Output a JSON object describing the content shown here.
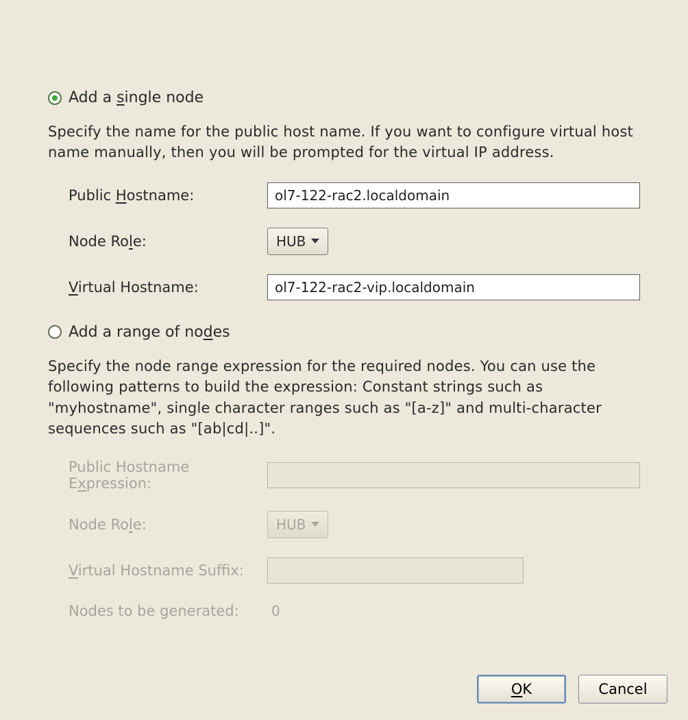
{
  "radio_single": {
    "label_pre": "Add a ",
    "label_mn": "s",
    "label_post": "ingle node",
    "selected": true
  },
  "desc_single": "Specify the name for the public host name. If you want to configure virtual host name manually, then you will be prompted for the virtual IP address.",
  "single": {
    "public_hostname": {
      "label_pre": "Public ",
      "label_mn": "H",
      "label_post": "ostname:",
      "value": "ol7-122-rac2.localdomain"
    },
    "node_role": {
      "label_pre": "Node Ro",
      "label_mn": "l",
      "label_post": "e:",
      "value": "HUB"
    },
    "virtual_hostname": {
      "label_mn": "V",
      "label_post": "irtual Hostname:",
      "value": "ol7-122-rac2-vip.localdomain"
    }
  },
  "radio_range": {
    "label_pre": "Add a range of no",
    "label_mn": "d",
    "label_post": "es",
    "selected": false
  },
  "desc_range": "Specify the node range expression for the required nodes. You can use the following patterns to build the expression: Constant strings such as \"myhostname\", single character ranges such as \"[a-z]\" and multi-character sequences such as \"[ab|cd|..]\".",
  "range": {
    "public_expr": {
      "label_pre": "Public Hostname E",
      "label_mn": "x",
      "label_post": "pression:",
      "value": ""
    },
    "node_role": {
      "label_pre": "Node Ro",
      "label_mn": "l",
      "label_post": "e:",
      "value": "HUB"
    },
    "virtual_suffix": {
      "label_mn": "V",
      "label_post": "irtual Hostname Suffix:",
      "value": ""
    },
    "generated": {
      "label": "Nodes to be generated:",
      "value": "0"
    }
  },
  "buttons": {
    "ok_mn": "O",
    "ok_post": "K",
    "cancel": "Cancel"
  }
}
